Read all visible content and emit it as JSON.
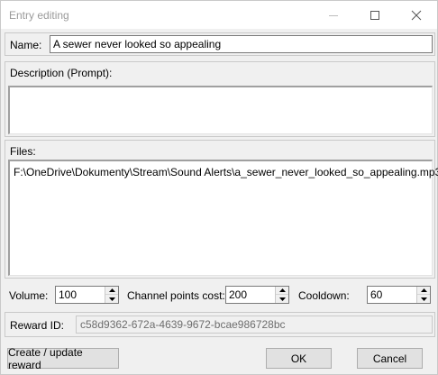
{
  "window": {
    "title": "Entry editing"
  },
  "name": {
    "label": "Name:",
    "value": "A sewer never looked so appealing"
  },
  "description": {
    "label": "Description (Prompt):",
    "value": ""
  },
  "files": {
    "label": "Files:",
    "items": [
      "F:\\OneDrive\\Dokumenty\\Stream\\Sound Alerts\\a_sewer_never_looked_so_appealing.mp3"
    ]
  },
  "volume": {
    "label": "Volume:",
    "value": "100"
  },
  "channel_points": {
    "label": "Channel points cost:",
    "value": "200"
  },
  "cooldown": {
    "label": "Cooldown:",
    "value": "60"
  },
  "reward": {
    "label": "Reward ID:",
    "value": "c58d9362-672a-4639-9672-bcae986728bc"
  },
  "buttons": {
    "create_update": "Create / update reward",
    "ok": "OK",
    "cancel": "Cancel"
  },
  "icons": {
    "minimize": "minimize-icon",
    "maximize": "maximize-icon",
    "close": "close-icon"
  }
}
